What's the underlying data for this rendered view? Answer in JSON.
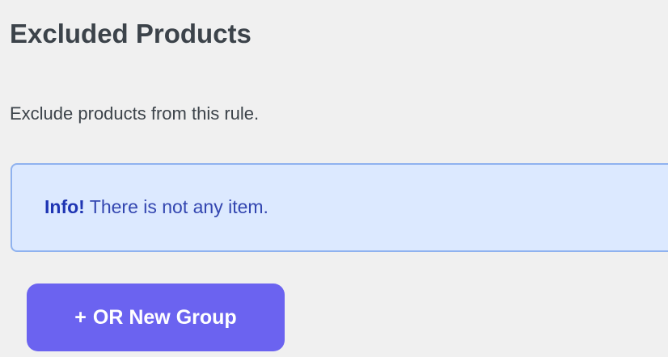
{
  "section": {
    "title": "Excluded Products",
    "description": "Exclude products from this rule."
  },
  "notice": {
    "strong": "Info!",
    "message": " There is not any item."
  },
  "button": {
    "icon_glyph": "+",
    "label": "OR New Group"
  },
  "colors": {
    "background": "#f0f0f0",
    "notice_bg": "#dce9ff",
    "notice_border": "#8fb2ef",
    "notice_text": "#3346b0",
    "button_bg": "#6b63f0",
    "button_text": "#ffffff"
  }
}
